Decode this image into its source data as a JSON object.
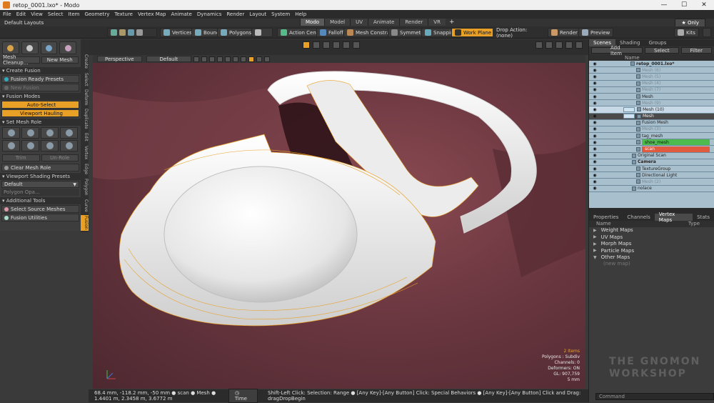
{
  "window": {
    "title": "retop_0001.lxo* - Modo",
    "buttons": [
      "—",
      "☐",
      "✕"
    ]
  },
  "menu": [
    "File",
    "Edit",
    "View",
    "Select",
    "Item",
    "Geometry",
    "Texture",
    "Vertex Map",
    "Animate",
    "Dynamics",
    "Render",
    "Layout",
    "System",
    "Help"
  ],
  "layout_bar": {
    "layouts_label": "Default Layouts",
    "tabs": [
      "Modo",
      "Model",
      "UV",
      "Animate",
      "Render",
      "VR"
    ],
    "active_tab": "Modo",
    "only_label": "Only",
    "plus": "+"
  },
  "toolbar": {
    "vertices": "Vertices",
    "bounds": "Bounds",
    "polygons": "Polygons",
    "action_center": "Action Center",
    "falloff": "Falloff",
    "mesh_constraint": "Mesh Constraint",
    "symmetry": "Symmetry",
    "snapping": "Snapping",
    "work_plane": "Work Plane",
    "drop_action": "Drop Action: (none)",
    "render": "Render",
    "preview": "Preview",
    "kits": "Kits"
  },
  "left_panel": {
    "mesh_cleanup": "Mesh Cleanup...",
    "new_mesh": "New Mesh",
    "create_fusion": "Create Fusion",
    "fusion_ready_presets": "Fusion Ready Presets",
    "new_fusion": "New Fusion",
    "fusion_modes": "Fusion Modes",
    "auto_select": "Auto-Select",
    "viewport_hauling": "Viewport Hauling",
    "set_mesh_role": "Set Mesh Role",
    "trim": "Trim",
    "un_role": "Un-Role",
    "clear_mesh_role": "Clear Mesh Role",
    "viewport_shading_presets": "Viewport Shading Presets",
    "default": "Default",
    "polygon_opacity": "Polygon Opa...",
    "additional_tools": "Additional Tools",
    "select_source_meshes": "Select Source Meshes",
    "fusion_utilities": "Fusion Utilities"
  },
  "left_vertical_tabs": [
    "Create",
    "Select",
    "Deform",
    "Duplicate",
    "Edit",
    "Vertex",
    "Edge",
    "Polygon",
    "Curve",
    "Fusion"
  ],
  "viewport": {
    "perspective": "Perspective",
    "default": "Default",
    "info": {
      "items": "2 Items",
      "polygons": "Polygons : Subdiv",
      "channels": "Channels: 0",
      "deformers": "Deformers: ON",
      "gl": "GL: 907,759",
      "scale": "5 mm"
    }
  },
  "status_bar": {
    "coords": "68.4 mm, -118.2 mm, -50 mm  ● scan  ● Mesh  ● 1.4401 m, 2.3458 m, 3.6772 m",
    "time_button": "Time",
    "hint": "Shift-Left Click: Selection: Range ●  [Any Key]-[Any Button] Click: Special Behaviors ●  [Any Key]-[Any Button] Click and Drag: dragDropBegin"
  },
  "scene_panel": {
    "tabs": [
      "Scenes",
      "Shading",
      "Groups"
    ],
    "add_item": "Add Item",
    "select": "Select",
    "filter": "Filter",
    "column_name": "Name",
    "items": [
      {
        "label": "retop_0001.lxo*",
        "kind": "scene"
      },
      {
        "label": "Mesh (6)",
        "kind": "dim"
      },
      {
        "label": "Mesh (5)",
        "kind": "dim"
      },
      {
        "label": "Mesh (4)",
        "kind": "dim"
      },
      {
        "label": "Mesh (7)",
        "kind": "dim"
      },
      {
        "label": "Mesh",
        "kind": "mesh"
      },
      {
        "label": "Mesh (9)",
        "kind": "dim"
      },
      {
        "label": "Mesh (10)",
        "kind": "selected"
      },
      {
        "label": "Mesh",
        "kind": "selected2"
      },
      {
        "label": "Fusion Mesh",
        "kind": "mesh"
      },
      {
        "label": "Mesh (3)",
        "kind": "dim"
      },
      {
        "label": "tag_mesh",
        "kind": "mesh"
      },
      {
        "label": "shoe_mesh",
        "kind": "green"
      },
      {
        "label": "scan",
        "kind": "red"
      },
      {
        "label": "Original Scan",
        "kind": "group"
      },
      {
        "label": "Camera",
        "kind": "camera"
      },
      {
        "label": "TextureGroup",
        "kind": "mesh"
      },
      {
        "label": "Directional Light",
        "kind": "mesh"
      },
      {
        "label": "Mesh (2)",
        "kind": "dim"
      },
      {
        "label": "nolace",
        "kind": "group"
      }
    ]
  },
  "lower_panel": {
    "tabs": [
      "Properties",
      "Channels",
      "Vertex Maps",
      "Stats"
    ],
    "active_tab": "Vertex Maps",
    "columns": [
      "Name",
      "Type"
    ],
    "maps": [
      "Weight Maps",
      "UV Maps",
      "Morph Maps",
      "Particle Maps",
      "Other Maps"
    ],
    "new_map": "(new map)"
  },
  "command_placeholder": "Command",
  "watermark": [
    "THE GNOMON",
    "WORKSHOP"
  ],
  "colors": {
    "accent": "#e8a026",
    "viewport_bg": "#6b3740",
    "scene_bg": "#a8bfcd",
    "green_row": "#4dbb4d",
    "red_row": "#e05a40"
  }
}
